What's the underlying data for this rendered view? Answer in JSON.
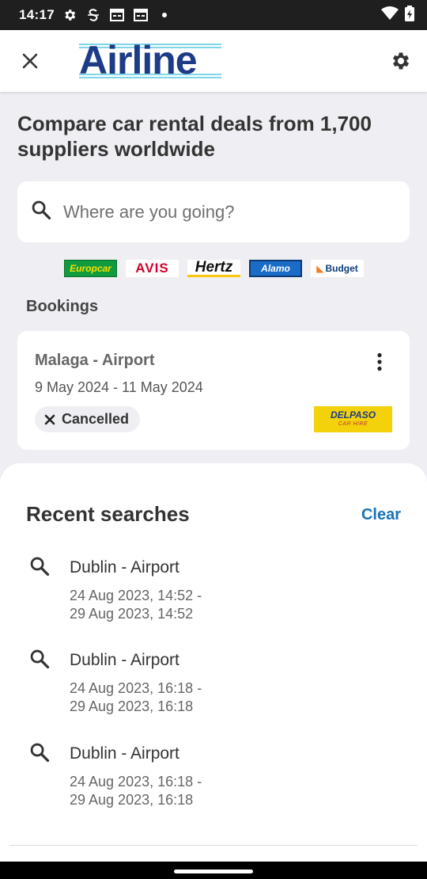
{
  "status_bar": {
    "time": "14:17",
    "icons": [
      "gear-icon",
      "s-icon",
      "calendar-icon",
      "calendar-icon",
      "dot-icon"
    ],
    "right_icons": [
      "wifi-icon",
      "battery-icon"
    ]
  },
  "app_bar": {
    "logo_text": "Airline",
    "close_icon": "close-icon",
    "settings_icon": "gear-icon"
  },
  "headline": "Compare car rental deals from 1,700 suppliers worldwide",
  "search": {
    "placeholder": "Where are you going?",
    "value": ""
  },
  "brands": [
    {
      "name": "Europcar"
    },
    {
      "name": "AVIS"
    },
    {
      "name": "Hertz"
    },
    {
      "name": "Alamo"
    },
    {
      "name": "Budget"
    }
  ],
  "bookings": {
    "title": "Bookings",
    "items": [
      {
        "place": "Malaga - Airport",
        "dates": "9 May 2024 - 11 May 2024",
        "status": "Cancelled",
        "supplier_line1": "DELPASO",
        "supplier_line2": "CAR HIRE"
      }
    ]
  },
  "recent_searches": {
    "title": "Recent searches",
    "clear_label": "Clear",
    "items": [
      {
        "place": "Dublin - Airport",
        "dates": "24 Aug 2023, 14:52 -\n29 Aug 2023, 14:52"
      },
      {
        "place": "Dublin - Airport",
        "dates": "24 Aug 2023, 16:18 -\n29 Aug 2023, 16:18"
      },
      {
        "place": "Dublin - Airport",
        "dates": "24 Aug 2023, 16:18 -\n29 Aug 2023, 16:18"
      }
    ]
  },
  "colors": {
    "accent": "#1a73b8",
    "logo": "#1d3b86",
    "background": "#efeff3"
  }
}
